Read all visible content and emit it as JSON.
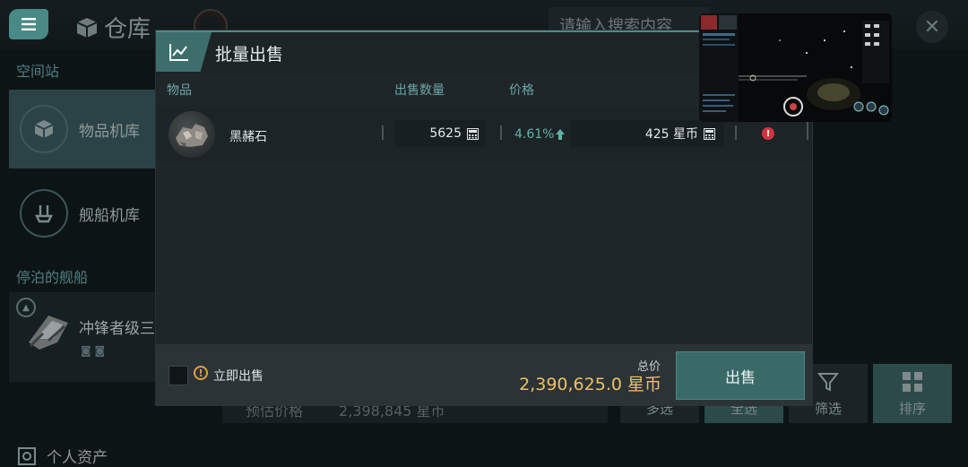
{
  "header": {
    "title": "仓库",
    "search_placeholder": "请输入搜索内容"
  },
  "sidebar": {
    "section_station": "空间站",
    "items": [
      {
        "label": "物品机库"
      },
      {
        "label": "舰船机库"
      }
    ],
    "section_docked": "停泊的舰船",
    "docked_ship": "冲锋者级三",
    "assets_label": "个人资产"
  },
  "background": {
    "estimate_label": "预估价格",
    "estimate_value": "2,398,845 星币",
    "buttons": [
      "多选",
      "全选",
      "筛选",
      "排序"
    ]
  },
  "modal": {
    "title": "批量出售",
    "columns": {
      "item": "物品",
      "quantity": "出售数量",
      "price": "价格"
    },
    "row": {
      "name": "黑赭石",
      "quantity": "5625",
      "change": "4.61%",
      "price": "425 星币",
      "warning": "!"
    },
    "footer": {
      "instant_sell": "立即出售",
      "total_label": "总价",
      "total_value": "2,390,625.0 星币",
      "sell_button": "出售"
    }
  },
  "colors": {
    "accent": "#4a8a86",
    "gold": "#f0c060",
    "positive": "#5fb3a4",
    "warning": "#d23340"
  }
}
